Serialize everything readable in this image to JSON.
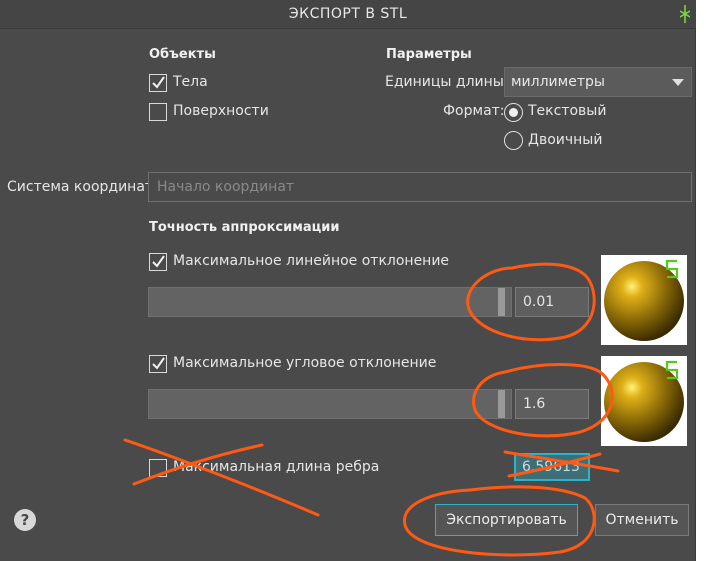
{
  "dialog": {
    "title": "ЭКСПОРТ В STL"
  },
  "objects": {
    "heading": "Объекты",
    "bodies": {
      "label": "Тела",
      "checked": true
    },
    "surfaces": {
      "label": "Поверхности",
      "checked": false
    }
  },
  "params": {
    "heading": "Параметры",
    "units_label": "Единицы длины:",
    "units_value": "миллиметры",
    "format_label": "Формат:",
    "format_options": [
      {
        "label": "Текстовый",
        "selected": true
      },
      {
        "label": "Двоичный",
        "selected": false
      }
    ]
  },
  "coords": {
    "label": "Система координат:",
    "placeholder": "Начало координат"
  },
  "accuracy": {
    "heading": "Точность аппроксимации",
    "linear": {
      "label": "Максимальное линейное отклонение",
      "checked": true,
      "value": "0.01"
    },
    "angular": {
      "label": "Максимальное угловое отклонение",
      "checked": true,
      "value": "1.6"
    },
    "edge": {
      "label": "Максимальная длина ребра",
      "checked": false,
      "value": "6.59613"
    }
  },
  "buttons": {
    "export": "Экспортировать",
    "cancel": "Отменить",
    "help": "?"
  },
  "colors": {
    "background": "#4a4a4a",
    "annotation": "#ff5a14",
    "focus": "#2bb3c8"
  }
}
